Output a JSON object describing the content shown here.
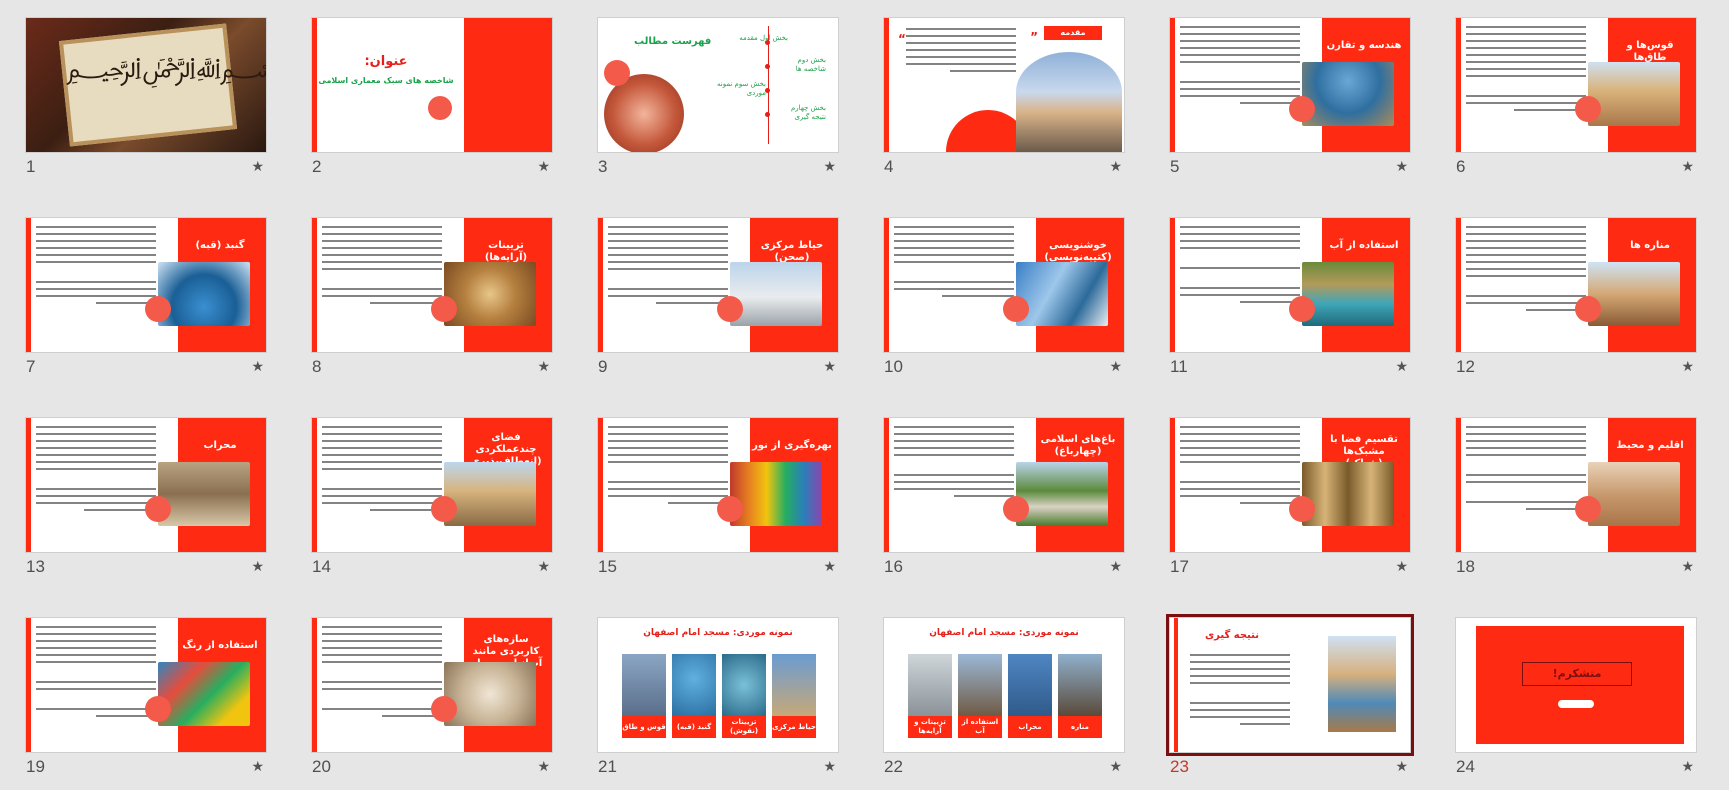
{
  "colors": {
    "accent": "#ff2a12",
    "green": "#1aa34a",
    "selected_border": "#7a0f12",
    "background": "#e6e6e6"
  },
  "selected_slide": 23,
  "slides": [
    {
      "n": "1"
    },
    {
      "n": "2",
      "title": "عنوان:",
      "subtitle": "شاخصه های سبک معماری اسلامی"
    },
    {
      "n": "3",
      "title": "فهرست مطالب",
      "items": [
        "بخش اول مقدمه",
        "بخش دوم شاخصه ها",
        "بخش سوم نمونه موردی",
        "بخش چهارم نتیجه گیری"
      ]
    },
    {
      "n": "4",
      "title": "مقدمه"
    },
    {
      "n": "5",
      "title": "هندسه و تقارن"
    },
    {
      "n": "6",
      "title": "قوس‌ها و طاق‌ها"
    },
    {
      "n": "7",
      "title": "گنبد (قبه)"
    },
    {
      "n": "8",
      "title": "تزیینات (آرایه‌ها)"
    },
    {
      "n": "9",
      "title": "حیاط مرکزی (صحن)"
    },
    {
      "n": "10",
      "title": "خوشنویسی (کتیبه‌نویسی)"
    },
    {
      "n": "11",
      "title": "استفاده از آب"
    },
    {
      "n": "12",
      "title": "مناره ها"
    },
    {
      "n": "13",
      "title": "محراب"
    },
    {
      "n": "14",
      "title": "فضای چندعملکردی (انعطاف‌پذیری فضا)"
    },
    {
      "n": "15",
      "title": "بهره‌گیری از نور"
    },
    {
      "n": "16",
      "title": "باغ‌های اسلامی (چهارباغ)"
    },
    {
      "n": "17",
      "title": "تقسیم فضا با مشبک‌ها (شباک)"
    },
    {
      "n": "18",
      "title": "اقلیم و محیط"
    },
    {
      "n": "19",
      "title": "استفاده از رنگ"
    },
    {
      "n": "20",
      "title": "سازه‌های کاربردی مانند آب‌انبار و حمام"
    },
    {
      "n": "21",
      "title": "نمونه موردی: مسجد امام اصفهان",
      "labels": [
        "قوس و طاق",
        "گنبد (قبه)",
        "تزیینات (نقوش)",
        "حیاط مرکزی"
      ]
    },
    {
      "n": "22",
      "title": "نمونه موردی: مسجد امام اصفهان",
      "labels": [
        "تزیینات و آرایه‌ها",
        "استفاده از آب",
        "محراب",
        "مناره"
      ]
    },
    {
      "n": "23",
      "title": "نتیجه گیری"
    },
    {
      "n": "24",
      "title": "متشکرم!"
    }
  ]
}
